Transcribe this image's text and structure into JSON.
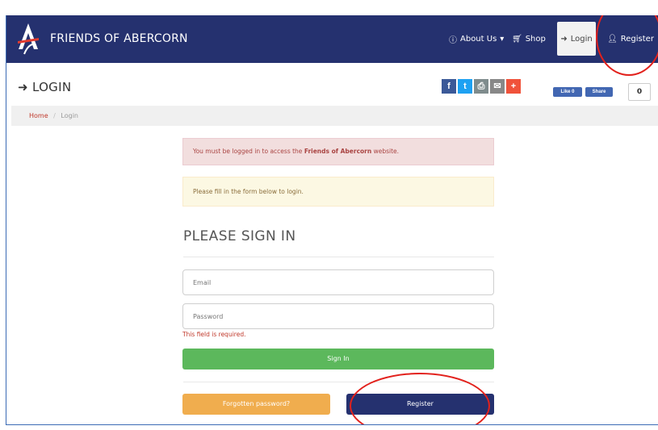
{
  "brand": {
    "name": "FRIENDS OF ABERCORN"
  },
  "nav": {
    "about": {
      "label": "About Us",
      "icon": "info-circle-icon"
    },
    "shop": {
      "label": "Shop",
      "icon": "cart-icon"
    },
    "login": {
      "label": "Login",
      "icon": "sign-in-icon"
    },
    "register": {
      "label": "Register",
      "icon": "user-icon"
    }
  },
  "page": {
    "title": "LOGIN",
    "icon": "sign-in-icon"
  },
  "share": {
    "buttons": [
      {
        "name": "facebook",
        "glyph": "f",
        "color": "#3b5998"
      },
      {
        "name": "twitter",
        "glyph": "t",
        "color": "#1da1f2"
      },
      {
        "name": "print",
        "glyph": "⎙",
        "color": "#7f8c8d"
      },
      {
        "name": "email",
        "glyph": "✉",
        "color": "#888888"
      },
      {
        "name": "more",
        "glyph": "+",
        "color": "#f0523a"
      }
    ],
    "like_label": "Like 0",
    "share_label": "Share",
    "count": "0"
  },
  "breadcrumb": {
    "home": "Home",
    "separator": "/",
    "current": "Login"
  },
  "alerts": {
    "danger_prefix": "You must be logged in to access the ",
    "danger_strong": "Friends of Abercorn",
    "danger_suffix": " website.",
    "warning": "Please fill in the form below to login."
  },
  "form": {
    "title": "PLEASE SIGN IN",
    "email_placeholder": "Email",
    "password_placeholder": "Password",
    "error": "This field is required.",
    "signin_label": "Sign In",
    "forgot_label": "Forgotten password?",
    "register_label": "Register"
  },
  "colors": {
    "navbar": "#25316f",
    "annotation": "#e2211c",
    "success": "#5cb85c",
    "warning": "#f0ad4e"
  }
}
